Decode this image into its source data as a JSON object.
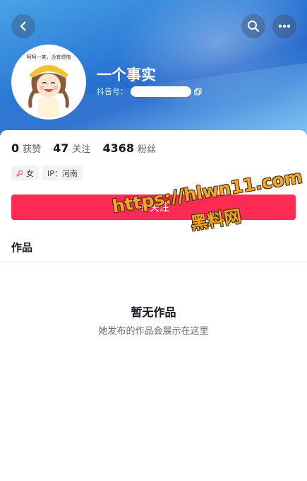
{
  "header": {
    "back_icon": "chevron-left-icon",
    "search_icon": "search-icon",
    "more_icon": "more-horizontal-icon"
  },
  "profile": {
    "avatar_caption": "呵呵一笑，没有烦恼",
    "nickname": "一个事实",
    "account_label": "抖音号："
  },
  "stats": [
    {
      "value": "0",
      "label": "获赞"
    },
    {
      "value": "47",
      "label": "关注"
    },
    {
      "value": "4368",
      "label": "粉丝"
    }
  ],
  "tags": {
    "gender": "女",
    "location": "IP：河南"
  },
  "follow_button": {
    "label": "关注"
  },
  "works": {
    "tab_label": "作品",
    "empty_title": "暂无作品",
    "empty_subtitle": "她发布的作品会展示在这里"
  },
  "watermark": {
    "url": "https://hlwn11.com",
    "name": "黑料网"
  },
  "colors": {
    "follow": "#fe2c55",
    "header_blue": "#2f7fd8",
    "watermark": "#f6a623"
  }
}
